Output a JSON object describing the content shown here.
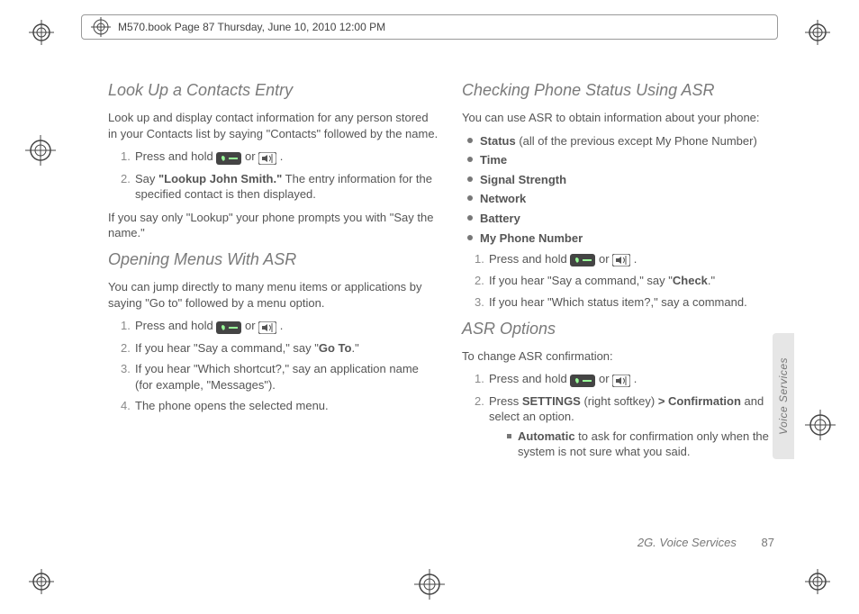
{
  "header": {
    "text": "M570.book  Page 87  Thursday, June 10, 2010  12:00 PM"
  },
  "left": {
    "h1": "Look Up a Contacts Entry",
    "p1a": "Look up and display contact information for any person stored in your Contacts list by saying \"Contacts\" followed by the name.",
    "li1_a": "Press and hold ",
    "li1_or": " or ",
    "li1_dot": " .",
    "li2_a": "Say ",
    "li2_b": "\"Lookup John Smith.\"",
    "li2_c": " The entry information for the specified contact is then displayed.",
    "p1b": "If you say only \"Lookup\" your phone prompts you with \"Say the name.\"",
    "h2": "Opening Menus With ASR",
    "p2a": "You can jump directly to many menu items or applications by saying \"Go to\" followed by a menu option.",
    "li2_1a": "Press and hold ",
    "li2_1or": " or ",
    "li2_1dot": " .",
    "li2_2a": "If you hear \"Say a command,\" say \"",
    "li2_2b": "Go To",
    "li2_2c": ".\"",
    "li2_3": "If you hear \"Which shortcut?,\" say an application name (for example, \"Messages\").",
    "li2_4": "The phone opens the selected menu."
  },
  "right": {
    "h1": "Checking Phone Status Using ASR",
    "p1": "You can use ASR to obtain information about your phone:",
    "bul1_a": "Status",
    "bul1_b": " (all of the previous except My Phone Number)",
    "bul2": "Time",
    "bul3": "Signal Strength",
    "bul4": "Network",
    "bul5": "Battery",
    "bul6": "My Phone Number",
    "li1_a": "Press and hold ",
    "li1_or": " or ",
    "li1_dot": " .",
    "li2_a": "If you hear \"Say a command,\" say \"",
    "li2_b": "Check",
    "li2_c": ".\"",
    "li3": "If you hear \"Which status item?,\" say a command.",
    "h2": "ASR Options",
    "p2": "To change ASR confirmation:",
    "li2_1a": "Press and hold ",
    "li2_1or": " or ",
    "li2_1dot": " .",
    "li2_2a": "Press ",
    "li2_2b": "SETTINGS",
    "li2_2c": " (right softkey) ",
    "li2_2gt": ">",
    "li2_2d": " Confirmation",
    "li2_2e": " and select an option.",
    "sub_a": "Automatic",
    "sub_b": " to ask for confirmation only when the system is not sure what you said."
  },
  "sidetab": "Voice Services",
  "footer": {
    "section": "2G. Voice Services",
    "page": "87"
  },
  "nums": {
    "n1": "1.",
    "n2": "2.",
    "n3": "3.",
    "n4": "4."
  }
}
